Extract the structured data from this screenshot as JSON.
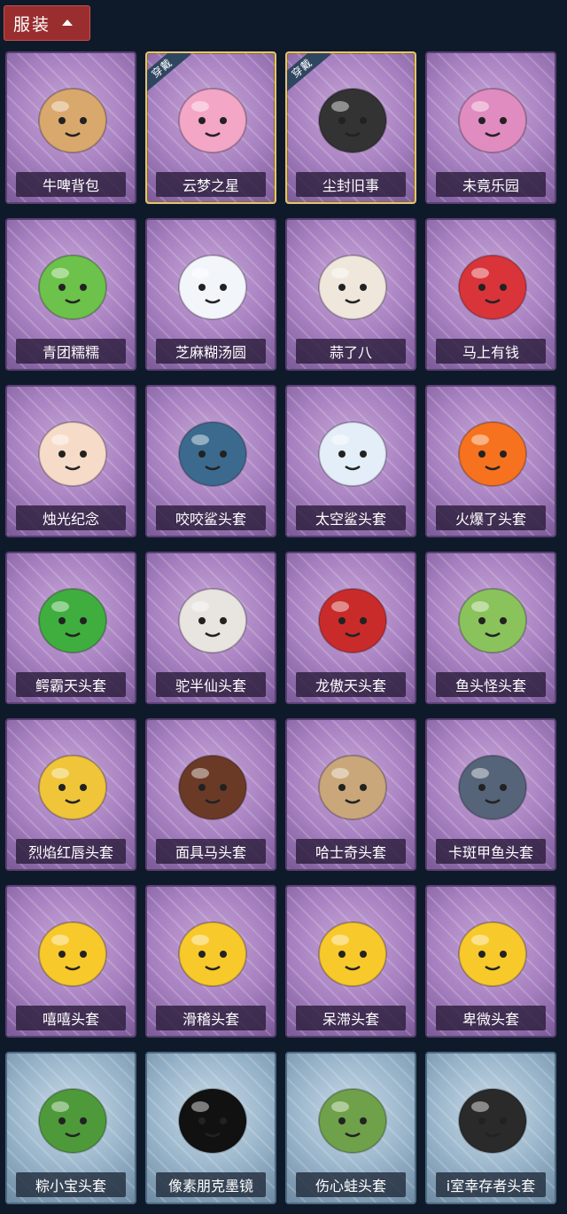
{
  "header": {
    "title": "服装"
  },
  "worn_label": "穿戴",
  "items": [
    {
      "name": "牛啤背包",
      "worn": false,
      "theme": "purple",
      "icon": "cow-backpack-icon",
      "color": "#d9a86c"
    },
    {
      "name": "云梦之星",
      "worn": true,
      "theme": "purple",
      "icon": "unicorn-star-icon",
      "color": "#f4a6c6"
    },
    {
      "name": "尘封旧事",
      "worn": true,
      "theme": "purple",
      "icon": "doll-keychain-icon",
      "color": "#333333"
    },
    {
      "name": "未竟乐园",
      "worn": false,
      "theme": "purple",
      "icon": "clown-doll-icon",
      "color": "#e08cc0"
    },
    {
      "name": "青团糯糯",
      "worn": false,
      "theme": "purple",
      "icon": "green-dumpling-icon",
      "color": "#6cc24a"
    },
    {
      "name": "芝麻糊汤圆",
      "worn": false,
      "theme": "purple",
      "icon": "rice-ball-icon",
      "color": "#f2f6fb"
    },
    {
      "name": "蒜了八",
      "worn": false,
      "theme": "purple",
      "icon": "garlic-icon",
      "color": "#efe7dc"
    },
    {
      "name": "马上有钱",
      "worn": false,
      "theme": "purple",
      "icon": "red-horse-icon",
      "color": "#d9343a"
    },
    {
      "name": "烛光纪念",
      "worn": false,
      "theme": "purple",
      "icon": "candle-icon",
      "color": "#f6dcc8"
    },
    {
      "name": "咬咬鲨头套",
      "worn": false,
      "theme": "purple",
      "icon": "shark-mask-icon",
      "color": "#3b6a8e"
    },
    {
      "name": "太空鲨头套",
      "worn": false,
      "theme": "purple",
      "icon": "space-shark-icon",
      "color": "#e3eef8"
    },
    {
      "name": "火爆了头套",
      "worn": false,
      "theme": "purple",
      "icon": "fire-head-icon",
      "color": "#f6721e"
    },
    {
      "name": "鳄霸天头套",
      "worn": false,
      "theme": "purple",
      "icon": "crocodile-head-icon",
      "color": "#3fae3f"
    },
    {
      "name": "驼半仙头套",
      "worn": false,
      "theme": "purple",
      "icon": "bear-head-icon",
      "color": "#e8e4e0"
    },
    {
      "name": "龙傲天头套",
      "worn": false,
      "theme": "purple",
      "icon": "dragon-head-icon",
      "color": "#c92b2b"
    },
    {
      "name": "鱼头怪头套",
      "worn": false,
      "theme": "purple",
      "icon": "fish-head-icon",
      "color": "#8ac35c"
    },
    {
      "name": "烈焰红唇头套",
      "worn": false,
      "theme": "purple",
      "icon": "pikachu-mask-icon",
      "color": "#f0c53a"
    },
    {
      "name": "面具马头套",
      "worn": false,
      "theme": "purple",
      "icon": "horse-mask-icon",
      "color": "#6b3a27"
    },
    {
      "name": "哈士奇头套",
      "worn": false,
      "theme": "purple",
      "icon": "husky-head-icon",
      "color": "#c9a77a"
    },
    {
      "name": "卡斑甲鱼头套",
      "worn": false,
      "theme": "purple",
      "icon": "seal-head-icon",
      "color": "#556478"
    },
    {
      "name": "嘻嘻头套",
      "worn": false,
      "theme": "purple",
      "icon": "grin-emoji-icon",
      "color": "#f8c92a"
    },
    {
      "name": "滑稽头套",
      "worn": false,
      "theme": "purple",
      "icon": "funny-emoji-icon",
      "color": "#f8c92a"
    },
    {
      "name": "呆滞头套",
      "worn": false,
      "theme": "purple",
      "icon": "stare-emoji-icon",
      "color": "#f8c92a"
    },
    {
      "name": "卑微头套",
      "worn": false,
      "theme": "purple",
      "icon": "humble-emoji-icon",
      "color": "#f8c92a"
    },
    {
      "name": "粽小宝头套",
      "worn": false,
      "theme": "blue",
      "icon": "zongzi-head-icon",
      "color": "#4e9a3a"
    },
    {
      "name": "像素朋克墨镜",
      "worn": false,
      "theme": "blue",
      "icon": "pixel-sunglasses-icon",
      "color": "#111111"
    },
    {
      "name": "伤心蛙头套",
      "worn": false,
      "theme": "blue",
      "icon": "sad-frog-icon",
      "color": "#6ea14a"
    },
    {
      "name": "i室幸存者头套",
      "worn": false,
      "theme": "blue",
      "icon": "gas-mask-icon",
      "color": "#2a2a2a"
    }
  ]
}
